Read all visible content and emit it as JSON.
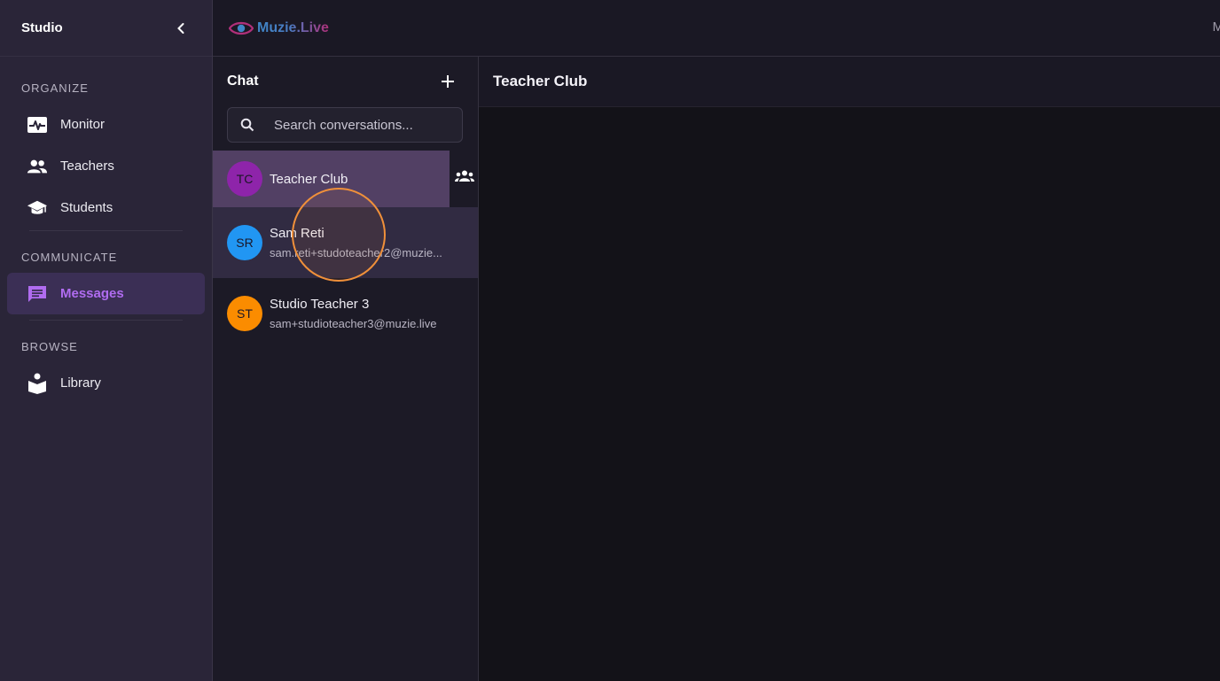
{
  "sidebar": {
    "title": "Studio",
    "sections": [
      {
        "label": "ORGANIZE",
        "items": [
          {
            "label": "Monitor",
            "icon": "monitor-heart-icon"
          },
          {
            "label": "Teachers",
            "icon": "people-icon"
          },
          {
            "label": "Students",
            "icon": "graduation-cap-icon"
          }
        ]
      },
      {
        "label": "COMMUNICATE",
        "items": [
          {
            "label": "Messages",
            "icon": "chat-icon",
            "active": true
          }
        ]
      },
      {
        "label": "BROWSE",
        "items": [
          {
            "label": "Library",
            "icon": "library-icon"
          }
        ]
      }
    ]
  },
  "topbar": {
    "logo_text": "Muzie.Live",
    "right_text": "M"
  },
  "chat": {
    "title": "Chat",
    "search_placeholder": "Search conversations...",
    "conversations": [
      {
        "initials": "TC",
        "name": "Teacher Club",
        "subtitle": "",
        "color": "#8e24aa",
        "group": true
      },
      {
        "initials": "SR",
        "name": "Sam Reti",
        "subtitle": "sam.reti+studoteacher2@muzie...",
        "color": "#2196f3"
      },
      {
        "initials": "ST",
        "name": "Studio Teacher 3",
        "subtitle": "sam+studioteacher3@muzie.live",
        "color": "#fb8c00"
      }
    ]
  },
  "main": {
    "title": "Teacher Club"
  },
  "colors": {
    "accent": "#b06cf0",
    "sidebar_bg": "#2a2538",
    "click_ring": "#f0903a"
  }
}
